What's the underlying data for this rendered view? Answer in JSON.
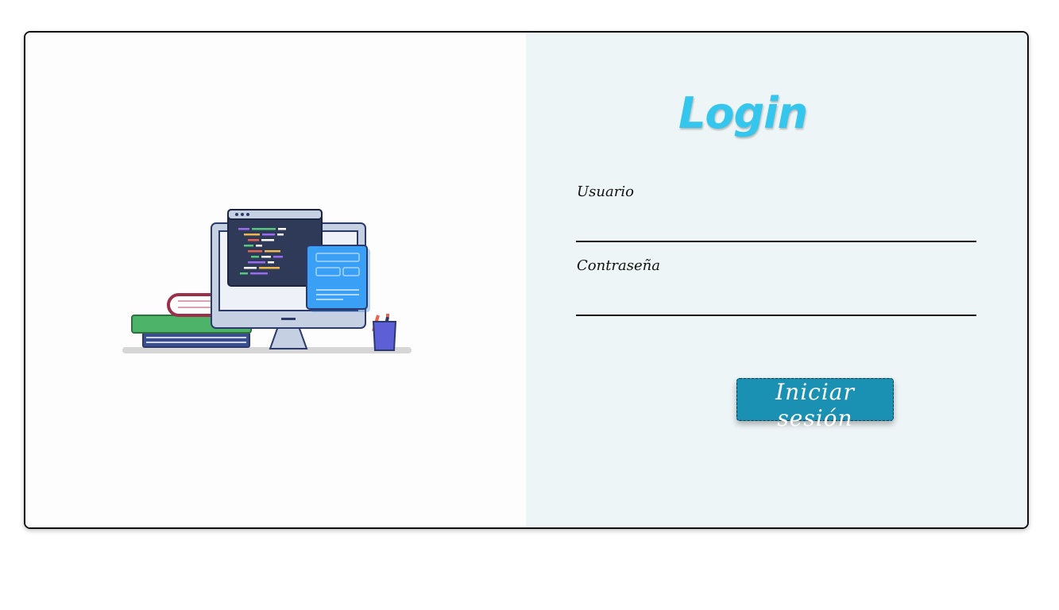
{
  "login": {
    "title": "Login",
    "username_label": "Usuario",
    "username_value": "",
    "password_label": "Contraseña",
    "password_value": "",
    "submit_label": "Iniciar sesión"
  },
  "illustration": {
    "icon": "desktop-computer-illustration"
  },
  "colors": {
    "title": "#35c6ee",
    "button_bg": "#1a90b3",
    "right_panel_bg": "#edf5f7"
  }
}
